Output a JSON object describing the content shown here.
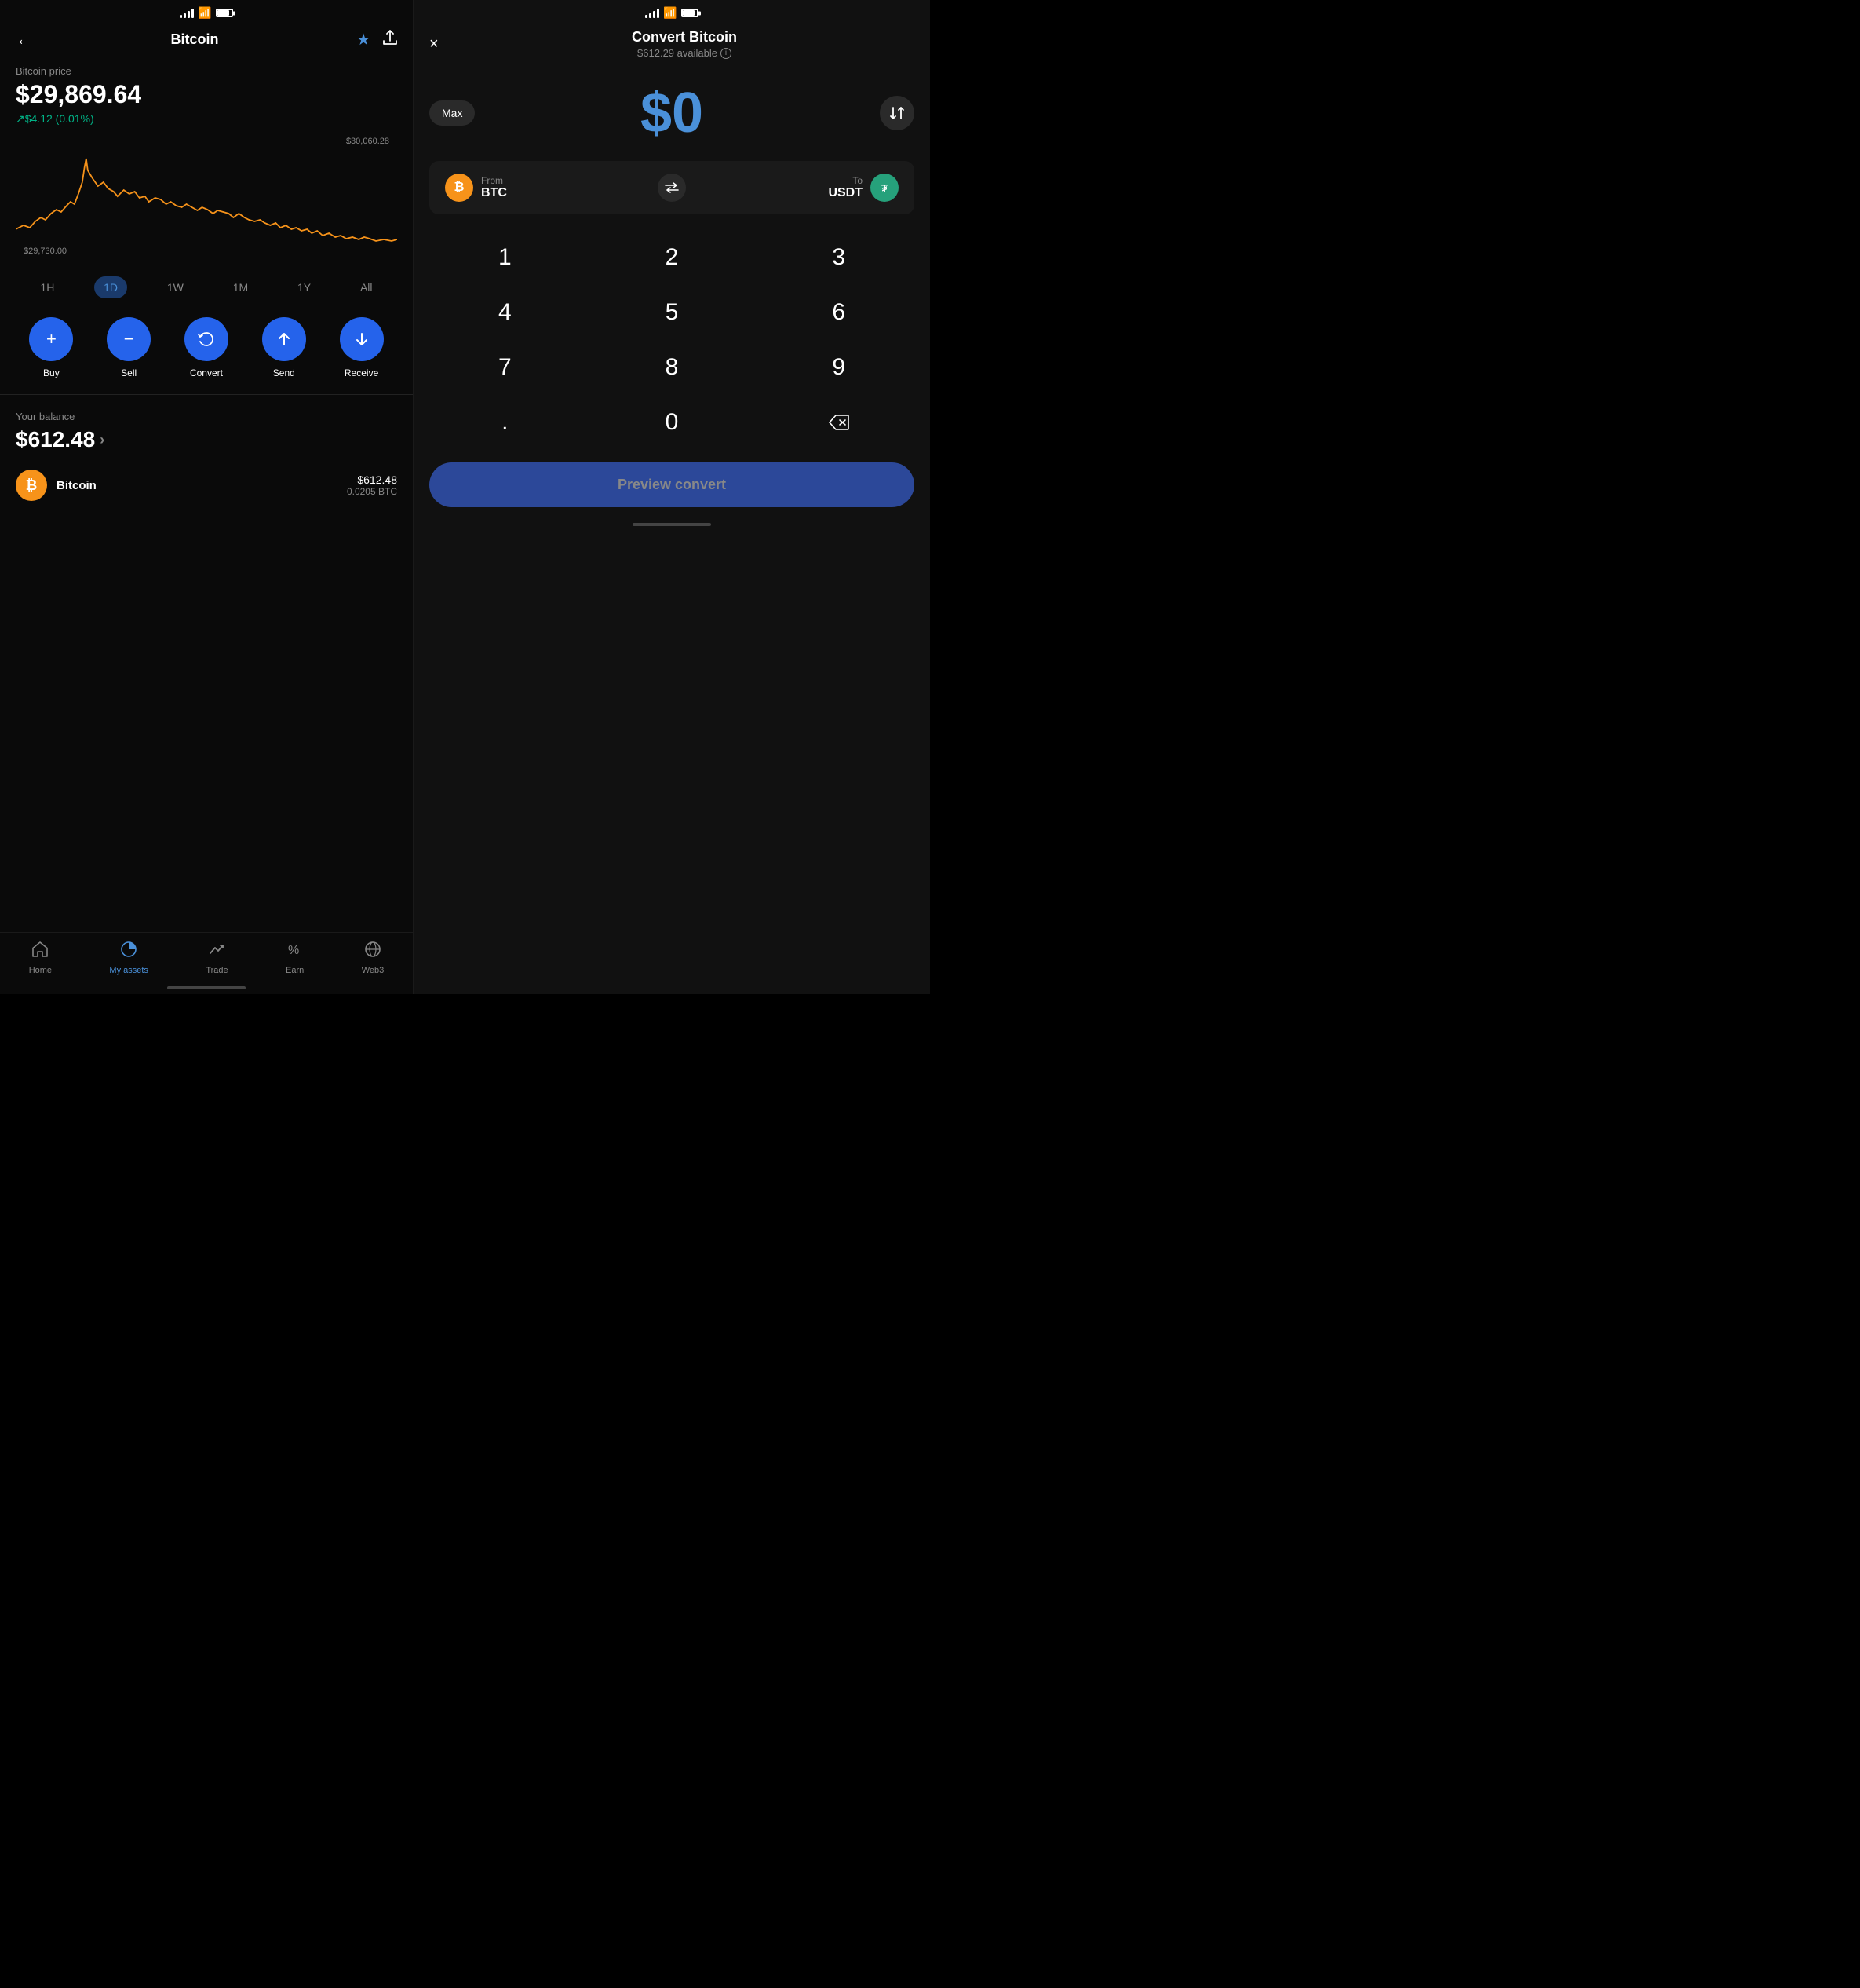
{
  "left": {
    "nav": {
      "back_label": "←",
      "title": "Bitcoin",
      "star": "★",
      "share": "↑"
    },
    "price_section": {
      "label": "Bitcoin price",
      "price": "$29,869.64",
      "change": "↗$4.12 (0.01%)"
    },
    "chart": {
      "high_label": "$30,060.28",
      "low_label": "$29,730.00"
    },
    "time_filters": [
      {
        "label": "1H",
        "active": false
      },
      {
        "label": "1D",
        "active": true
      },
      {
        "label": "1W",
        "active": false
      },
      {
        "label": "1M",
        "active": false
      },
      {
        "label": "1Y",
        "active": false
      },
      {
        "label": "All",
        "active": false
      }
    ],
    "actions": [
      {
        "label": "Buy",
        "icon": "+"
      },
      {
        "label": "Sell",
        "icon": "−"
      },
      {
        "label": "Convert",
        "icon": "↻"
      },
      {
        "label": "Send",
        "icon": "↑"
      },
      {
        "label": "Receive",
        "icon": "↓"
      }
    ],
    "balance": {
      "label": "Your balance",
      "amount": "$612.48"
    },
    "asset": {
      "name": "Bitcoin",
      "symbol": "₿",
      "usd": "$612.48",
      "btc": "0.0205 BTC"
    },
    "bottom_nav": [
      {
        "label": "Home",
        "icon": "⌂",
        "active": false
      },
      {
        "label": "My assets",
        "icon": "◑",
        "active": true
      },
      {
        "label": "Trade",
        "icon": "↗",
        "active": false
      },
      {
        "label": "Earn",
        "icon": "%",
        "active": false
      },
      {
        "label": "Web3",
        "icon": "◎",
        "active": false
      }
    ]
  },
  "right": {
    "header": {
      "close": "×",
      "title": "Convert Bitcoin",
      "available": "$612.29 available"
    },
    "amount": {
      "max_label": "Max",
      "value": "$0",
      "swap_icon": "⇅"
    },
    "conversion": {
      "from_label": "From",
      "from_value": "BTC",
      "swap": "⇄",
      "to_label": "To",
      "to_value": "USDT"
    },
    "numpad": [
      {
        "key": "1"
      },
      {
        "key": "2"
      },
      {
        "key": "3"
      },
      {
        "key": "4"
      },
      {
        "key": "5"
      },
      {
        "key": "6"
      },
      {
        "key": "7"
      },
      {
        "key": "8"
      },
      {
        "key": "9"
      },
      {
        "key": "."
      },
      {
        "key": "0"
      },
      {
        "key": "⌫"
      }
    ],
    "preview_btn": "Preview convert"
  }
}
